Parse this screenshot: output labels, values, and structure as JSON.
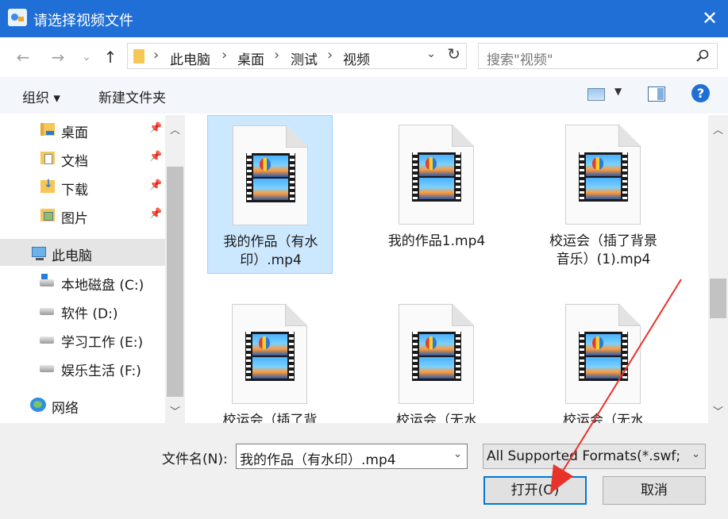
{
  "window": {
    "title": "请选择视频文件",
    "close_glyph": "✕"
  },
  "address_bar": {
    "back_glyph": "←",
    "forward_glyph": "→",
    "recent_glyph": "⌄",
    "up_glyph": "↑",
    "separator_glyph": "›",
    "crumbs": [
      "此电脑",
      "桌面",
      "测试",
      "视频"
    ],
    "dropdown_glyph": "⌄",
    "refresh_glyph": "↻"
  },
  "search": {
    "placeholder": "搜索\"视频\""
  },
  "toolbar": {
    "organize_label": "组织 ▾",
    "new_folder_label": "新建文件夹",
    "view_dropdown_glyph": "▼",
    "help_glyph": "?"
  },
  "sidebar": {
    "pin_glyph": "📌",
    "items": [
      {
        "label": "桌面",
        "icon": "desktop-folder-icon",
        "pinned": true
      },
      {
        "label": "文档",
        "icon": "documents-folder-icon",
        "pinned": true
      },
      {
        "label": "下载",
        "icon": "downloads-folder-icon",
        "pinned": true
      },
      {
        "label": "图片",
        "icon": "pictures-folder-icon",
        "pinned": true
      },
      {
        "label": "此电脑",
        "icon": "this-pc-icon",
        "selected": true
      },
      {
        "label": "本地磁盘 (C:)",
        "icon": "system-drive-icon"
      },
      {
        "label": "软件 (D:)",
        "icon": "drive-icon"
      },
      {
        "label": "学习工作 (E:)",
        "icon": "drive-icon"
      },
      {
        "label": "娱乐生活 (F:)",
        "icon": "drive-icon"
      },
      {
        "label": "网络",
        "icon": "network-icon"
      }
    ],
    "scroll_up_glyph": "︿",
    "scroll_down_glyph": "﹀"
  },
  "files": [
    {
      "name": "我的作品（有水印）.mp4",
      "selected": true
    },
    {
      "name": "我的作品1.mp4"
    },
    {
      "name": "校运会（插了背景音乐）(1).mp4"
    },
    {
      "name": "校运会（插了背"
    },
    {
      "name": "校运会（无水"
    },
    {
      "name": "校运会（无水"
    }
  ],
  "bottom": {
    "filename_label": "文件名(N):",
    "filename_value": "我的作品（有水印）.mp4",
    "filter_value": "All Supported Formats(*.swf;",
    "dropdown_glyph": "⌄",
    "open_label": "打开(O)",
    "cancel_label": "取消"
  },
  "colors": {
    "titlebar": "#1f6fd6",
    "selection": "#cce8ff",
    "annotation_arrow": "#e8332a"
  }
}
